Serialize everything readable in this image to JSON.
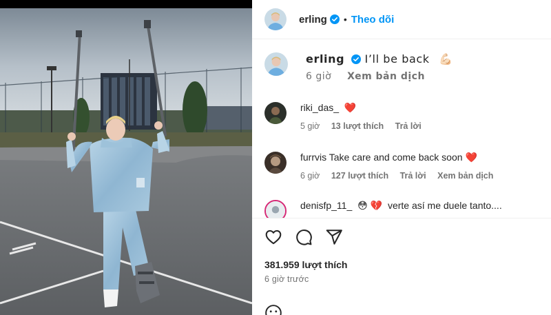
{
  "post": {
    "username": "erling",
    "separator": "•",
    "follow_label": "Theo dõi"
  },
  "caption": {
    "username": "erling",
    "text": "I’ll be back",
    "emoji": "💪🏻",
    "time": "6 giờ",
    "translate_label": "Xem bản dịch"
  },
  "comments": [
    {
      "username": "riki_das_",
      "text": "",
      "emoji": "❤️",
      "time": "5 giờ",
      "likes": "13 lượt thích",
      "reply": "Trả lời",
      "translate": ""
    },
    {
      "username": "furrvis",
      "text": "Take care and come back soon",
      "emoji": "❤️",
      "time": "6 giờ",
      "likes": "127 lượt thích",
      "reply": "Trả lời",
      "translate": "Xem bản dịch"
    },
    {
      "username": "denisfp_11_",
      "text": "verte así me duele tanto....",
      "emoji": "😳 💔",
      "time": "",
      "likes": "",
      "reply": "",
      "translate": ""
    }
  ],
  "stats": {
    "likes": "381.959 lượt thích",
    "posted": "6 giờ trước"
  },
  "icons": {
    "like": "heart-icon",
    "comment": "comment-icon",
    "share": "share-icon",
    "verified": "verified-badge-icon",
    "emoji": "emoji-icon"
  },
  "colors": {
    "accent": "#0095f6",
    "text": "#262626",
    "muted": "#737373",
    "heart": "#ed1c4a",
    "verified": "#0095f6"
  }
}
